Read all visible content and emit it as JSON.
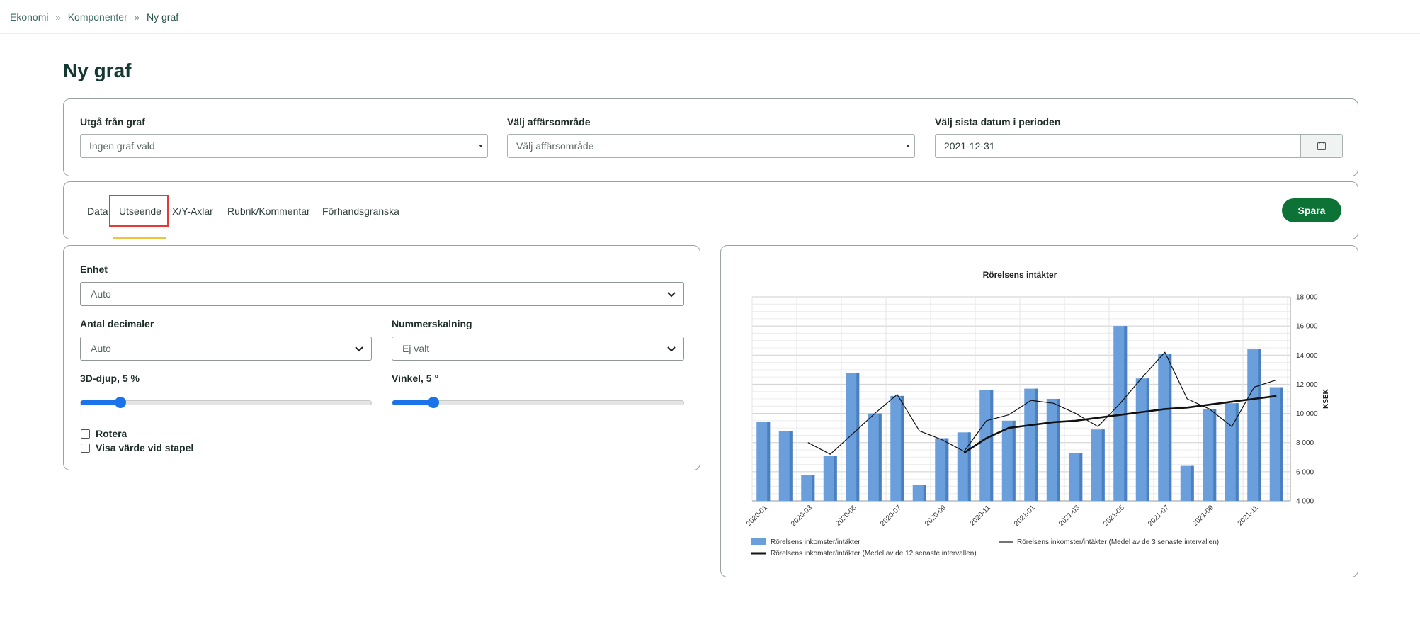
{
  "breadcrumb": {
    "items": [
      "Ekonomi",
      "Komponenter",
      "Ny graf"
    ]
  },
  "page": {
    "title": "Ny graf"
  },
  "filters": {
    "base_graph": {
      "label": "Utgå från graf",
      "value": "Ingen graf vald"
    },
    "business_area": {
      "label": "Välj affärsområde",
      "value": "Välj affärsområde"
    },
    "last_date": {
      "label": "Välj sista datum i perioden",
      "value": "2021-12-31"
    }
  },
  "tabs": {
    "items": [
      "Data",
      "Utseende",
      "X/Y-Axlar",
      "Rubrik/Kommentar",
      "Förhandsgranska"
    ],
    "active": "Utseende",
    "save_label": "Spara"
  },
  "settings": {
    "unit": {
      "label": "Enhet",
      "value": "Auto"
    },
    "decimals": {
      "label": "Antal decimaler",
      "value": "Auto"
    },
    "scaling": {
      "label": "Nummerskalning",
      "value": "Ej valt"
    },
    "depth": {
      "label": "3D-djup, 5 %",
      "value": 5
    },
    "angle": {
      "label": "Vinkel, 5 °",
      "value": 5
    },
    "rotate": {
      "label": "Rotera",
      "checked": false
    },
    "show_value": {
      "label": "Visa värde vid stapel",
      "checked": false
    }
  },
  "colors": {
    "accent": "#0c7236",
    "bar": "#6a9fdc",
    "tab_underline": "#f0c23b",
    "highlight": "#e53935"
  },
  "chart_data": {
    "type": "bar",
    "title": "Rörelsens intäkter",
    "ylabel": "KSEK",
    "ylim": [
      4000,
      18000
    ],
    "yticks": [
      "4 000",
      "6 000",
      "8 000",
      "10 000",
      "12 000",
      "14 000",
      "16 000",
      "18 000"
    ],
    "y_axis_side": "right",
    "categories": [
      "2020-01",
      "2020-02",
      "2020-03",
      "2020-04",
      "2020-05",
      "2020-06",
      "2020-07",
      "2020-08",
      "2020-09",
      "2020-10",
      "2020-11",
      "2020-12",
      "2021-01",
      "2021-02",
      "2021-03",
      "2021-04",
      "2021-05",
      "2021-06",
      "2021-07",
      "2021-08",
      "2021-09",
      "2021-10",
      "2021-11",
      "2021-12"
    ],
    "xtick_labels": [
      "2020-01",
      "2020-03",
      "2020-05",
      "2020-07",
      "2020-09",
      "2020-11",
      "2021-01",
      "2021-03",
      "2021-05",
      "2021-07",
      "2021-09",
      "2021-11"
    ],
    "series": [
      {
        "name": "Rörelsens inkomster/intäkter",
        "type": "bar",
        "values": [
          9400,
          8800,
          5800,
          7100,
          12800,
          10000,
          11200,
          5100,
          8300,
          8700,
          11600,
          9500,
          11700,
          11000,
          7300,
          8900,
          16000,
          12400,
          14100,
          6400,
          10300,
          10700,
          14400,
          11800
        ]
      },
      {
        "name": "Rörelsens inkomster/intäkter (Medel av de 3 senaste intervallen)",
        "type": "line",
        "values": [
          null,
          null,
          8000,
          7200,
          8600,
          10000,
          11300,
          8800,
          8200,
          7400,
          9500,
          9900,
          10900,
          10700,
          10000,
          9100,
          10700,
          12500,
          14200,
          11000,
          10300,
          9100,
          11800,
          12300
        ]
      },
      {
        "name": "Rörelsens inkomster/intäkter (Medel av de 12 senaste intervallen)",
        "type": "line",
        "values": [
          null,
          null,
          null,
          null,
          null,
          null,
          null,
          null,
          null,
          7300,
          8300,
          9000,
          9200,
          9400,
          9500,
          9700,
          9900,
          10100,
          10300,
          10400,
          10600,
          10800,
          11000,
          11200
        ]
      }
    ],
    "grid": true,
    "legend": "bottom"
  }
}
